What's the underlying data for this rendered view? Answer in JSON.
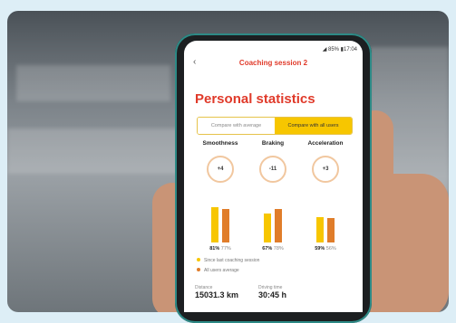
{
  "status": {
    "signal_battery": "85%",
    "time": "17:04"
  },
  "header": {
    "back_icon": "chevron-left",
    "title": "Coaching session 2"
  },
  "page": {
    "heading": "Personal statistics"
  },
  "toggle": {
    "left_label": "Compare with average",
    "right_label": "Compare with all users",
    "selected": "right"
  },
  "metrics": [
    {
      "name": "Smoothness",
      "delta": "+4",
      "current": "81%",
      "average": "77%",
      "current_level": 0.81,
      "average_level": 0.77
    },
    {
      "name": "Braking",
      "delta": "-11",
      "current": "67%",
      "average": "78%",
      "current_level": 0.67,
      "average_level": 0.78
    },
    {
      "name": "Acceleration",
      "delta": "+3",
      "current": "59%",
      "average": "56%",
      "current_level": 0.59,
      "average_level": 0.56
    }
  ],
  "legend": [
    {
      "label": "Since last coaching session",
      "color": "#f7c600"
    },
    {
      "label": "All users average",
      "color": "#e07d2a"
    }
  ],
  "summary": {
    "distance_label": "Distance",
    "distance_value": "15031.3 km",
    "driving_time_label": "Driving time",
    "driving_time_value": "30:45 h"
  },
  "colors": {
    "accent": "#e03a2a",
    "toggle_active": "#f7c600",
    "bar_current": "#f7c600",
    "bar_average": "#e07d2a"
  }
}
